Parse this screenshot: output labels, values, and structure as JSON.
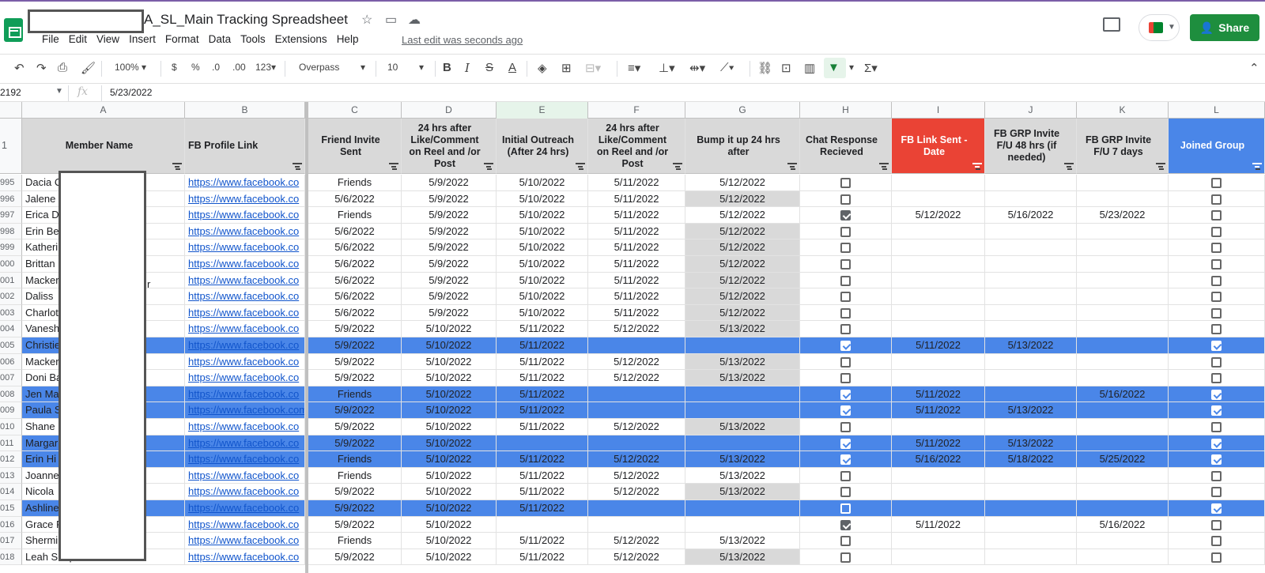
{
  "app": {
    "doc_title": "A_SL_Main Tracking Spreadsheet",
    "menus": [
      "File",
      "Edit",
      "View",
      "Insert",
      "Format",
      "Data",
      "Tools",
      "Extensions",
      "Help"
    ],
    "last_edit": "Last edit was seconds ago",
    "share_label": "Share"
  },
  "toolbar": {
    "zoom": "100%",
    "currency": "$",
    "percent": "%",
    "dec_less": ".0",
    "dec_more": ".00",
    "format_more": "123",
    "font": "Overpass",
    "font_size": "10"
  },
  "formula_bar": {
    "name_box": "2192",
    "fx": "fx",
    "value": "5/23/2022"
  },
  "columns": [
    "A",
    "B",
    "C",
    "D",
    "E",
    "F",
    "G",
    "H",
    "I",
    "J",
    "K",
    "L"
  ],
  "header_row": {
    "row_number": "1",
    "labels": [
      "Member Name",
      "FB Profile Link",
      "Friend Invite Sent",
      "24 hrs after Like/Comment on Reel and /or Post",
      "Initial Outreach (After 24 hrs)",
      "24 hrs after Like/Comment on Reel and /or Post",
      "Bump it up 24 hrs after",
      "Chat Response Recieved",
      "FB Link Sent - Date",
      "FB GRP Invite F/U 48 hrs (if needed)",
      "FB GRP Invite F/U 7 days",
      "Joined Group"
    ]
  },
  "rows": [
    {
      "n": "995",
      "name": "Dacia C",
      "link": "https://www.facebook.co",
      "c": "Friends",
      "d": "5/9/2022",
      "e": "5/10/2022",
      "f": "5/11/2022",
      "g": "5/12/2022",
      "h": false,
      "i": "",
      "j": "",
      "k": "",
      "l": false,
      "hl": false,
      "grey": false
    },
    {
      "n": "996",
      "name": "Jalene",
      "link": "https://www.facebook.co",
      "c": "5/6/2022",
      "d": "5/9/2022",
      "e": "5/10/2022",
      "f": "5/11/2022",
      "g": "5/12/2022",
      "h": false,
      "i": "",
      "j": "",
      "k": "",
      "l": false,
      "hl": false,
      "grey": true
    },
    {
      "n": "997",
      "name": "Erica D",
      "link": "https://www.facebook.co",
      "c": "Friends",
      "d": "5/9/2022",
      "e": "5/10/2022",
      "f": "5/11/2022",
      "g": "5/12/2022",
      "h": true,
      "i": "5/12/2022",
      "j": "5/16/2022",
      "k": "5/23/2022",
      "l": false,
      "hl": false,
      "grey": false
    },
    {
      "n": "998",
      "name": "Erin Be",
      "link": "https://www.facebook.co",
      "c": "5/6/2022",
      "d": "5/9/2022",
      "e": "5/10/2022",
      "f": "5/11/2022",
      "g": "5/12/2022",
      "h": false,
      "i": "",
      "j": "",
      "k": "",
      "l": false,
      "hl": false,
      "grey": true
    },
    {
      "n": "999",
      "name": "Katheri",
      "link": "https://www.facebook.co",
      "c": "5/6/2022",
      "d": "5/9/2022",
      "e": "5/10/2022",
      "f": "5/11/2022",
      "g": "5/12/2022",
      "h": false,
      "i": "",
      "j": "",
      "k": "",
      "l": false,
      "hl": false,
      "grey": true
    },
    {
      "n": "000",
      "name": "Brittan",
      "link": "https://www.facebook.co",
      "c": "5/6/2022",
      "d": "5/9/2022",
      "e": "5/10/2022",
      "f": "5/11/2022",
      "g": "5/12/2022",
      "h": false,
      "i": "",
      "j": "",
      "k": "",
      "l": false,
      "hl": false,
      "grey": true
    },
    {
      "n": "001",
      "name": "Macker",
      "link": "https://www.facebook.co",
      "c": "5/6/2022",
      "d": "5/9/2022",
      "e": "5/10/2022",
      "f": "5/11/2022",
      "g": "5/12/2022",
      "h": false,
      "i": "",
      "j": "",
      "k": "",
      "l": false,
      "hl": false,
      "grey": true
    },
    {
      "n": "002",
      "name": "Daliss",
      "link": "https://www.facebook.co",
      "c": "5/6/2022",
      "d": "5/9/2022",
      "e": "5/10/2022",
      "f": "5/11/2022",
      "g": "5/12/2022",
      "h": false,
      "i": "",
      "j": "",
      "k": "",
      "l": false,
      "hl": false,
      "grey": true
    },
    {
      "n": "003",
      "name": "Charlot",
      "link": "https://www.facebook.co",
      "c": "5/6/2022",
      "d": "5/9/2022",
      "e": "5/10/2022",
      "f": "5/11/2022",
      "g": "5/12/2022",
      "h": false,
      "i": "",
      "j": "",
      "k": "",
      "l": false,
      "hl": false,
      "grey": true
    },
    {
      "n": "004",
      "name": "Vanesh",
      "link": "https://www.facebook.co",
      "c": "5/9/2022",
      "d": "5/10/2022",
      "e": "5/11/2022",
      "f": "5/12/2022",
      "g": "5/13/2022",
      "h": false,
      "i": "",
      "j": "",
      "k": "",
      "l": false,
      "hl": false,
      "grey": true
    },
    {
      "n": "005",
      "name": "Christie",
      "link": "https://www.facebook.co",
      "c": "5/9/2022",
      "d": "5/10/2022",
      "e": "5/11/2022",
      "f": "",
      "g": "",
      "h": true,
      "i": "5/11/2022",
      "j": "5/13/2022",
      "k": "",
      "l": true,
      "hl": true,
      "grey": false
    },
    {
      "n": "006",
      "name": "Macker",
      "link": "https://www.facebook.co",
      "c": "5/9/2022",
      "d": "5/10/2022",
      "e": "5/11/2022",
      "f": "5/12/2022",
      "g": "5/13/2022",
      "h": false,
      "i": "",
      "j": "",
      "k": "",
      "l": false,
      "hl": false,
      "grey": true
    },
    {
      "n": "007",
      "name": "Doni Ba",
      "link": "https://www.facebook.co",
      "c": "5/9/2022",
      "d": "5/10/2022",
      "e": "5/11/2022",
      "f": "5/12/2022",
      "g": "5/13/2022",
      "h": false,
      "i": "",
      "j": "",
      "k": "",
      "l": false,
      "hl": false,
      "grey": true
    },
    {
      "n": "008",
      "name": "Jen Ma",
      "link": "https://www.facebook.co",
      "c": "Friends",
      "d": "5/10/2022",
      "e": "5/11/2022",
      "f": "",
      "g": "",
      "h": true,
      "i": "5/11/2022",
      "j": "",
      "k": "5/16/2022",
      "l": true,
      "hl": true,
      "grey": false
    },
    {
      "n": "009",
      "name": "Paula S",
      "link": "https://www.facebook.com",
      "c": "5/9/2022",
      "d": "5/10/2022",
      "e": "5/11/2022",
      "f": "",
      "g": "",
      "h": true,
      "i": "5/11/2022",
      "j": "5/13/2022",
      "k": "",
      "l": true,
      "hl": true,
      "grey": false
    },
    {
      "n": "010",
      "name": "Shane",
      "link": "https://www.facebook.co",
      "c": "5/9/2022",
      "d": "5/10/2022",
      "e": "5/11/2022",
      "f": "5/12/2022",
      "g": "5/13/2022",
      "h": false,
      "i": "",
      "j": "",
      "k": "",
      "l": false,
      "hl": false,
      "grey": true
    },
    {
      "n": "011",
      "name": "Margar",
      "link": "https://www.facebook.co",
      "c": "5/9/2022",
      "d": "5/10/2022",
      "e": "",
      "f": "",
      "g": "",
      "h": true,
      "i": "5/11/2022",
      "j": "5/13/2022",
      "k": "",
      "l": true,
      "hl": true,
      "grey": false
    },
    {
      "n": "012",
      "name": "Erin Hi",
      "link": "https://www.facebook.co",
      "c": "Friends",
      "d": "5/10/2022",
      "e": "5/11/2022",
      "f": "5/12/2022",
      "g": "5/13/2022",
      "h": true,
      "i": "5/16/2022",
      "j": "5/18/2022",
      "k": "5/25/2022",
      "l": true,
      "hl": true,
      "grey": false
    },
    {
      "n": "013",
      "name": "Joanne",
      "link": "https://www.facebook.co",
      "c": "Friends",
      "d": "5/10/2022",
      "e": "5/11/2022",
      "f": "5/12/2022",
      "g": "5/13/2022",
      "h": false,
      "i": "",
      "j": "",
      "k": "",
      "l": false,
      "hl": false,
      "grey": false
    },
    {
      "n": "014",
      "name": "Nicola",
      "link": "https://www.facebook.co",
      "c": "5/9/2022",
      "d": "5/10/2022",
      "e": "5/11/2022",
      "f": "5/12/2022",
      "g": "5/13/2022",
      "h": false,
      "i": "",
      "j": "",
      "k": "",
      "l": false,
      "hl": false,
      "grey": true
    },
    {
      "n": "015",
      "name": "Ashline",
      "link": "https://www.facebook.co",
      "c": "5/9/2022",
      "d": "5/10/2022",
      "e": "5/11/2022",
      "f": "",
      "g": "",
      "h": false,
      "i": "",
      "j": "",
      "k": "",
      "l": true,
      "hl": true,
      "grey": false
    },
    {
      "n": "016",
      "name": "Grace F",
      "link": "https://www.facebook.co",
      "c": "5/9/2022",
      "d": "5/10/2022",
      "e": "",
      "f": "",
      "g": "",
      "h": true,
      "i": "5/11/2022",
      "j": "",
      "k": "5/16/2022",
      "l": false,
      "hl": false,
      "grey": false
    },
    {
      "n": "017",
      "name": "Shermi",
      "link": "https://www.facebook.co",
      "c": "Friends",
      "d": "5/10/2022",
      "e": "5/11/2022",
      "f": "5/12/2022",
      "g": "5/13/2022",
      "h": false,
      "i": "",
      "j": "",
      "k": "",
      "l": false,
      "hl": false,
      "grey": false
    },
    {
      "n": "018",
      "name": "Leah Shapiro",
      "link": "https://www.facebook.co",
      "c": "5/9/2022",
      "d": "5/10/2022",
      "e": "5/11/2022",
      "f": "5/12/2022",
      "g": "5/13/2022",
      "h": false,
      "i": "",
      "j": "",
      "k": "",
      "l": false,
      "hl": false,
      "grey": true
    }
  ],
  "stray_text": "r"
}
